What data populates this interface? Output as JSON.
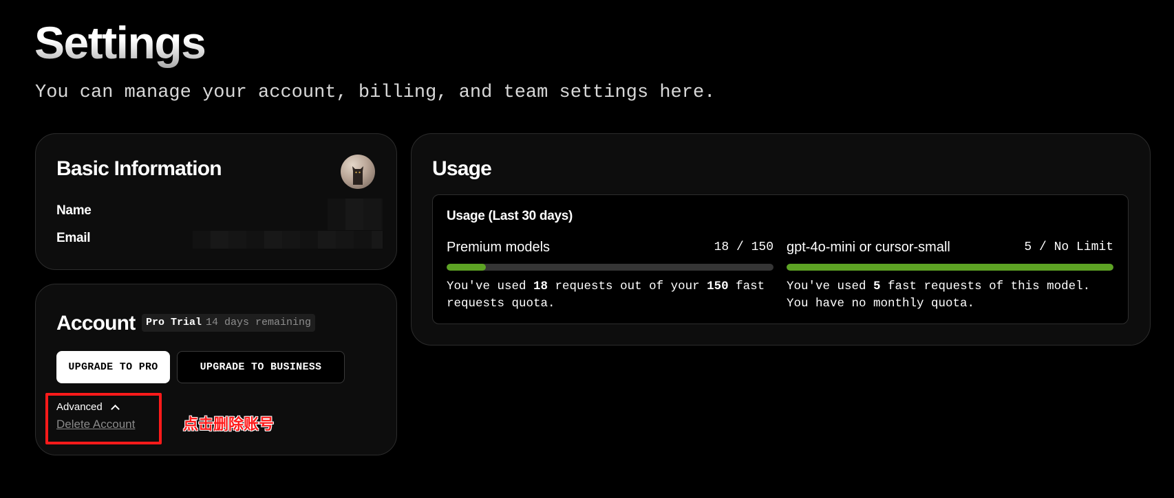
{
  "page": {
    "title": "Settings",
    "subtitle": "You can manage your account, billing, and team settings here."
  },
  "basic_information": {
    "title": "Basic Information",
    "name_label": "Name",
    "email_label": "Email"
  },
  "account": {
    "title": "Account",
    "plan": "Pro Trial",
    "remaining": "14 days remaining",
    "upgrade_pro_label": "UPGRADE TO PRO",
    "upgrade_business_label": "UPGRADE TO BUSINESS",
    "advanced_label": "Advanced",
    "delete_label": "Delete Account"
  },
  "annotation": {
    "text": "点击删除账号",
    "color": "#ff1a1a"
  },
  "usage": {
    "title": "Usage",
    "period_label": "Usage (Last 30 days)",
    "models": [
      {
        "name": "Premium models",
        "count": "18 / 150",
        "used": 18,
        "quota": 150,
        "progress": 0.12,
        "desc_pre": "You've used ",
        "desc_used": "18",
        "desc_mid": " requests out of your ",
        "desc_quota": "150",
        "desc_post": " fast requests quota."
      },
      {
        "name": "gpt-4o-mini or cursor-small",
        "count": "5 / No Limit",
        "used": 5,
        "progress": 1.0,
        "desc_pre": "You've used ",
        "desc_used": "5",
        "desc_mid": " fast requests of this model. You have no monthly quota."
      }
    ],
    "bar_color": "#5da324"
  }
}
